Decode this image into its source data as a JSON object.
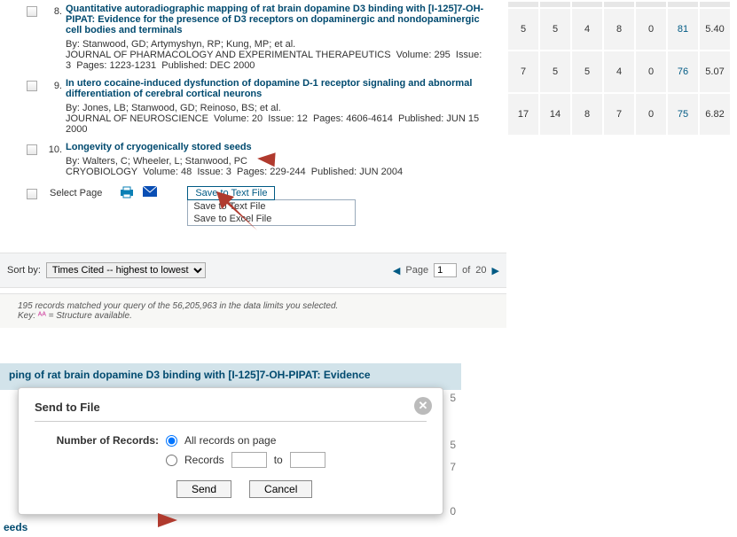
{
  "results": [
    {
      "num": "8.",
      "title": "Quantitative autoradiographic mapping of rat brain dopamine D3 binding with [I-125]7-OH-PIPAT: Evidence for the presence of D3 receptors on dopaminergic and nondopaminergic cell bodies and terminals",
      "by": "By: Stanwood, GD; Artymyshyn, RP; Kung, MP; et al.",
      "jline": "JOURNAL OF PHARMACOLOGY AND EXPERIMENTAL THERAPEUTICS  Volume: 295  Issue: 3  Pages: 1223-1231  Published: DEC 2000",
      "metrics": [
        "5",
        "5",
        "4",
        "8",
        "0",
        "81",
        "5.40"
      ]
    },
    {
      "num": "9.",
      "title": "In utero cocaine-induced dysfunction of dopamine D-1 receptor signaling and abnormal differentiation of cerebral cortical neurons",
      "by": "By: Jones, LB; Stanwood, GD; Reinoso, BS; et al.",
      "jline": "JOURNAL OF NEUROSCIENCE  Volume: 20  Issue: 12  Pages: 4606-4614  Published: JUN 15 2000",
      "metrics": [
        "7",
        "5",
        "5",
        "4",
        "0",
        "76",
        "5.07"
      ]
    },
    {
      "num": "10.",
      "title": "Longevity of cryogenically stored seeds",
      "by": "By: Walters, C; Wheeler, L; Stanwood, PC",
      "jline": "CRYOBIOLOGY  Volume: 48  Issue: 3  Pages: 229-244  Published: JUN 2004",
      "metrics": [
        "17",
        "14",
        "8",
        "7",
        "0",
        "75",
        "6.82"
      ]
    }
  ],
  "toolbar": {
    "select_page": "Select Page",
    "save_btn": "Save to Text File",
    "dd_text": "Save to Text File",
    "dd_excel": "Save to Excel File"
  },
  "sort": {
    "label": "Sort by:",
    "value": "Times Cited -- highest to lowest"
  },
  "pager": {
    "page_word": "Page",
    "page_val": "1",
    "of": "of",
    "total": "20"
  },
  "footer": {
    "line1": "195 records matched your query of the 56,205,963 in the data limits you selected.",
    "key_label": "Key:",
    "key_text": " = Structure available."
  },
  "modal": {
    "bg_title": "ping of rat brain dopamine D3 binding with [I-125]7-OH-PIPAT: Evidence",
    "title": "Send to File",
    "num_label": "Number of Records:",
    "opt_all": "All records on page",
    "opt_range": "Records",
    "range_to": "to",
    "send": "Send",
    "cancel": "Cancel",
    "clip_left_eeds": "eeds",
    "side5a": "5",
    "side5b": "5",
    "side7": "7",
    "side0": "0"
  }
}
